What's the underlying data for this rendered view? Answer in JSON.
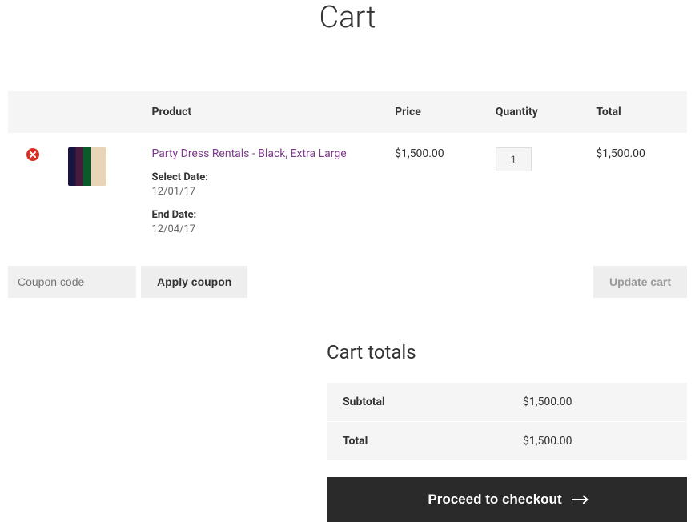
{
  "page_title": "Cart",
  "table": {
    "headers": {
      "product": "Product",
      "price": "Price",
      "quantity": "Quantity",
      "total": "Total"
    },
    "item": {
      "name": "Party Dress Rentals - Black, Extra Large",
      "price": "$1,500.00",
      "quantity": "1",
      "total": "$1,500.00",
      "select_date_label": "Select Date:",
      "select_date_value": "12/01/17",
      "end_date_label": "End Date:",
      "end_date_value": "12/04/17"
    }
  },
  "coupon": {
    "placeholder": "Coupon code",
    "apply_label": "Apply coupon"
  },
  "update_cart_label": "Update cart",
  "totals": {
    "title": "Cart totals",
    "subtotal_label": "Subtotal",
    "subtotal_value": "$1,500.00",
    "total_label": "Total",
    "total_value": "$1,500.00"
  },
  "checkout_label": "Proceed to checkout"
}
